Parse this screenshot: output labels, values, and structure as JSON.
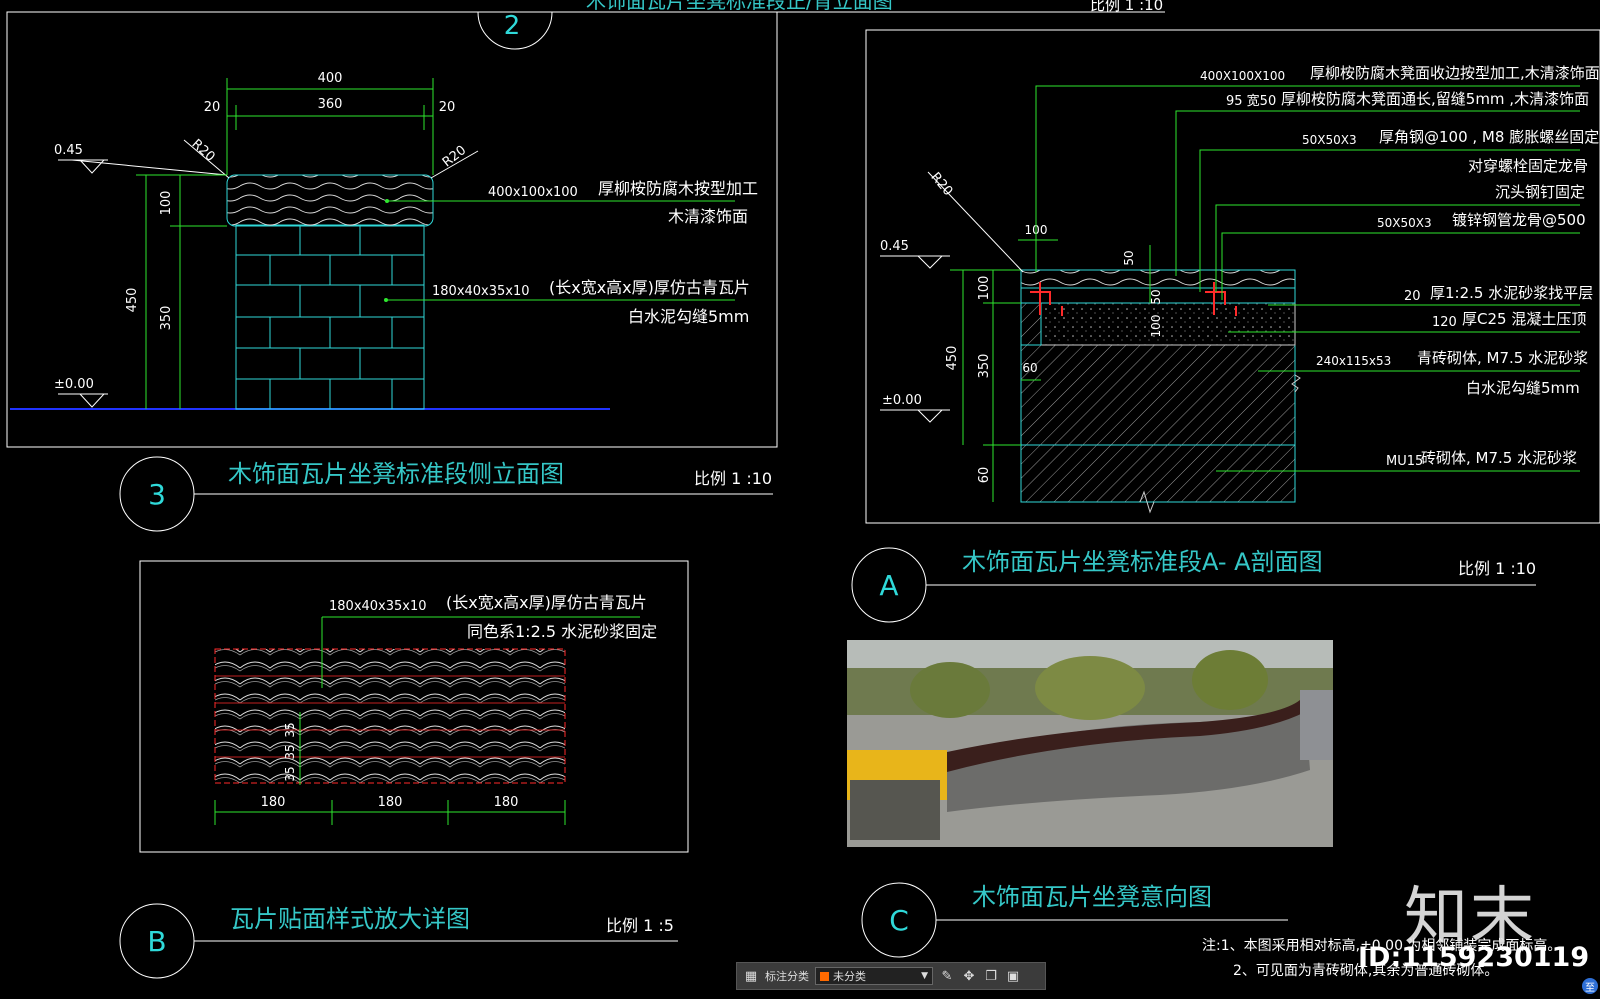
{
  "colors": {
    "frame": "#ffffff",
    "dim": "#2ee62e",
    "cyan": "#2fd9d9",
    "title": "#35c7c7",
    "text": "#ffffff",
    "red": "#ff2a2a",
    "ground": "#2033ff"
  },
  "panel2": {
    "circle": "2",
    "title_partial": "木饰面瓦片坐凳标准段正/背立面图",
    "scale_partial": "比例 1 :10"
  },
  "panel3": {
    "circle": "3",
    "title": "木饰面瓦片坐凳标准段侧立面图",
    "scale": "比例  1 :10",
    "dims": {
      "top": "400",
      "left": "20",
      "mid": "360",
      "right": "20",
      "r_left": "R20",
      "r_right": "R20",
      "lvl_top": "0.45",
      "lvl_zero": "±0.00",
      "h_total": "450",
      "h_top": "100",
      "h_base": "350"
    },
    "labels": {
      "cap_spec": "400x100x100",
      "cap_desc1": "厚柳桉防腐木按型加工",
      "cap_desc2": "木清漆饰面",
      "tile_spec": "180x40x35x10",
      "tile_desc1": "(长x宽x高x厚)厚仿古青瓦片",
      "tile_desc2": "白水泥勾缝5mm"
    }
  },
  "panelA": {
    "circle": "A",
    "title": "木饰面瓦片坐凳标准段A- A剖面图",
    "scale": "比例  1 :10",
    "dims": {
      "r": "R20",
      "w100": "100",
      "lvl_top": "0.45",
      "lvl_zero": "±0.00",
      "h_total": "450",
      "h100": "100",
      "h350": "350",
      "h60": "60",
      "w60": "60",
      "d50a": "50",
      "d50b": "50",
      "d20": "20",
      "d100": "100"
    },
    "labels": [
      {
        "spec": "400X100X100",
        "desc": "厚柳桉防腐木凳面收边按型加工,木清漆饰面"
      },
      {
        "spec": "95 宽50",
        "desc": "厚柳桉防腐木凳面通长,留缝5mm  ,木清漆饰面"
      },
      {
        "spec": "50X50X3",
        "desc": "厚角钢@100  , M8 膨胀螺丝固定"
      },
      {
        "spec": "",
        "desc": "对穿螺栓固定龙骨"
      },
      {
        "spec": "",
        "desc": "沉头钢钉固定"
      },
      {
        "spec": "50X50X3",
        "desc": "镀锌钢管龙骨@500"
      },
      {
        "spec": "20",
        "desc": "厚1:2.5  水泥砂浆找平层"
      },
      {
        "spec": "120",
        "desc": "厚C25  混凝土压顶"
      },
      {
        "spec": "240x115x53",
        "desc": "青砖砌体, M7.5  水泥砂浆"
      },
      {
        "spec": "",
        "desc": "白水泥勾缝5mm"
      },
      {
        "spec": "MU15",
        "desc": "砖砌体, M7.5  水泥砂浆"
      }
    ]
  },
  "panelB": {
    "circle": "B",
    "title": "瓦片贴面样式放大详图",
    "scale": "比例  1 :5",
    "labels": {
      "spec": "180x40x35x10",
      "desc1": "(长x宽x高x厚)厚仿古青瓦片",
      "desc2": "同色系1:2.5  水泥砂浆固定",
      "d1": "180",
      "d2": "180",
      "d3": "180",
      "v1": "35",
      "v2": "35",
      "v3": "35"
    }
  },
  "panelC": {
    "circle": "C",
    "title": "木饰面瓦片坐凳意向图",
    "notes": [
      "注:1、本图采用相对标高,±0.00 为相邻铺装完成面标高。",
      "2、可见面为青砖砌体,其余为普通砖砌体。"
    ]
  },
  "watermark": {
    "logo": "知末",
    "id": "ID:1159230119",
    "corner": "至"
  },
  "toolbar": {
    "label": "标注分类",
    "value": "未分类",
    "swatch": "#ff6a00"
  }
}
